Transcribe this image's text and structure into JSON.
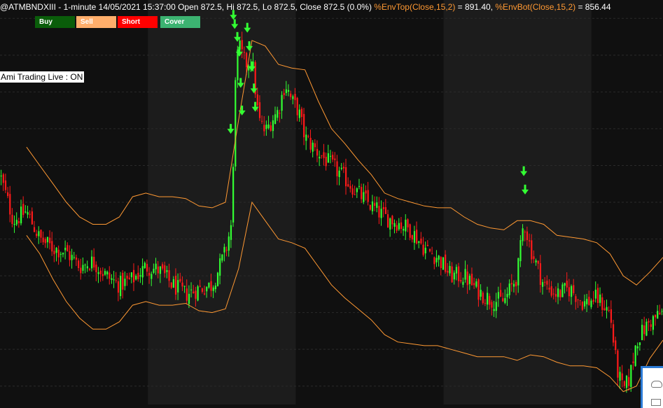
{
  "header": {
    "symbol_info": "@ATMBNDXIII - 1-minute 14/05/2021 15:37:00 Open 872.5, Hi 872.5, Lo 872.5, Close 872.5 (0.0%) ",
    "env_top_label": "%EnvTop(Close,15,2)",
    "env_top_value": " = 891.40, ",
    "env_bot_label": "%EnvBot(Close,15,2)",
    "env_bot_value": " = 856.44"
  },
  "toolbar": {
    "buy_label": "Buy",
    "sell_label": "Sell",
    "short_label": "Short",
    "cover_label": "Cover"
  },
  "status": {
    "text": "Ami Trading Live : ON"
  },
  "colors": {
    "background": "#101010",
    "band_alt": "#1c1c1c",
    "grid": "#2a2a2a",
    "up_candle": "#33ff33",
    "down_candle": "#ff1a1a",
    "envelope": "#ff9933",
    "signal_arrow": "#33ff33"
  },
  "chart_data": {
    "type": "candlestick",
    "interval": "1-minute",
    "date": "14/05/2021",
    "last_bar": {
      "time": "15:37:00",
      "open": 872.5,
      "high": 872.5,
      "low": 872.5,
      "close": 872.5,
      "change_pct": 0.0
    },
    "indicators": [
      {
        "name": "%EnvTop(Close,15,2)",
        "value": 891.4,
        "color": "#ff9933"
      },
      {
        "name": "%EnvBot(Close,15,2)",
        "value": 856.44,
        "color": "#ff9933"
      }
    ],
    "x_range": [
      0,
      100
    ],
    "y_range": [
      780,
      1000
    ],
    "grid": true,
    "legend": "top-left",
    "price_path": [
      [
        0,
        905
      ],
      [
        2,
        880
      ],
      [
        4,
        885
      ],
      [
        6,
        870
      ],
      [
        8,
        865
      ],
      [
        10,
        863
      ],
      [
        12,
        855
      ],
      [
        14,
        858
      ],
      [
        16,
        850
      ],
      [
        18,
        845
      ],
      [
        20,
        848
      ],
      [
        22,
        855
      ],
      [
        24,
        853
      ],
      [
        26,
        845
      ],
      [
        28,
        840
      ],
      [
        30,
        843
      ],
      [
        32,
        845
      ],
      [
        34,
        863
      ],
      [
        35,
        880
      ],
      [
        35.5,
        960
      ],
      [
        36,
        975
      ],
      [
        37,
        965
      ],
      [
        38,
        968
      ],
      [
        39,
        935
      ],
      [
        40,
        928
      ],
      [
        41,
        935
      ],
      [
        42,
        940
      ],
      [
        43,
        955
      ],
      [
        44,
        945
      ],
      [
        45,
        940
      ],
      [
        46,
        925
      ],
      [
        48,
        917
      ],
      [
        50,
        910
      ],
      [
        52,
        903
      ],
      [
        54,
        895
      ],
      [
        56,
        888
      ],
      [
        58,
        882
      ],
      [
        60,
        879
      ],
      [
        62,
        875
      ],
      [
        64,
        865
      ],
      [
        66,
        860
      ],
      [
        68,
        850
      ],
      [
        70,
        850
      ],
      [
        72,
        842
      ],
      [
        74,
        837
      ],
      [
        76,
        836
      ],
      [
        78,
        850
      ],
      [
        79,
        880
      ],
      [
        80,
        865
      ],
      [
        82,
        845
      ],
      [
        84,
        840
      ],
      [
        86,
        843
      ],
      [
        88,
        835
      ],
      [
        90,
        838
      ],
      [
        92,
        830
      ],
      [
        93,
        800
      ],
      [
        94,
        787
      ],
      [
        95,
        795
      ],
      [
        96,
        815
      ],
      [
        98,
        825
      ],
      [
        100,
        830
      ]
    ],
    "env_top": [
      [
        4,
        920
      ],
      [
        6,
        910
      ],
      [
        8,
        900
      ],
      [
        10,
        890
      ],
      [
        12,
        882
      ],
      [
        14,
        878
      ],
      [
        16,
        878
      ],
      [
        18,
        882
      ],
      [
        20,
        893
      ],
      [
        22,
        895
      ],
      [
        24,
        893
      ],
      [
        26,
        893
      ],
      [
        28,
        892
      ],
      [
        30,
        888
      ],
      [
        32,
        887
      ],
      [
        34,
        890
      ],
      [
        36,
        935
      ],
      [
        38,
        978
      ],
      [
        40,
        975
      ],
      [
        42,
        965
      ],
      [
        44,
        963
      ],
      [
        46,
        962
      ],
      [
        48,
        945
      ],
      [
        50,
        930
      ],
      [
        52,
        922
      ],
      [
        54,
        913
      ],
      [
        56,
        905
      ],
      [
        58,
        895
      ],
      [
        60,
        892
      ],
      [
        62,
        890
      ],
      [
        64,
        888
      ],
      [
        66,
        887
      ],
      [
        68,
        887
      ],
      [
        70,
        882
      ],
      [
        72,
        878
      ],
      [
        74,
        876
      ],
      [
        76,
        875
      ],
      [
        78,
        880
      ],
      [
        80,
        880
      ],
      [
        82,
        878
      ],
      [
        84,
        872
      ],
      [
        86,
        871
      ],
      [
        88,
        870
      ],
      [
        90,
        868
      ],
      [
        92,
        862
      ],
      [
        94,
        850
      ],
      [
        96,
        845
      ],
      [
        98,
        852
      ],
      [
        100,
        860
      ]
    ],
    "env_bot": [
      [
        4,
        872
      ],
      [
        6,
        862
      ],
      [
        8,
        848
      ],
      [
        10,
        836
      ],
      [
        12,
        827
      ],
      [
        14,
        821
      ],
      [
        16,
        821
      ],
      [
        18,
        825
      ],
      [
        20,
        834
      ],
      [
        22,
        836
      ],
      [
        24,
        834
      ],
      [
        26,
        834
      ],
      [
        28,
        835
      ],
      [
        30,
        831
      ],
      [
        32,
        830
      ],
      [
        34,
        832
      ],
      [
        36,
        854
      ],
      [
        38,
        890
      ],
      [
        40,
        880
      ],
      [
        42,
        870
      ],
      [
        44,
        868
      ],
      [
        46,
        865
      ],
      [
        48,
        855
      ],
      [
        50,
        845
      ],
      [
        52,
        838
      ],
      [
        54,
        832
      ],
      [
        56,
        826
      ],
      [
        58,
        818
      ],
      [
        60,
        814
      ],
      [
        62,
        813
      ],
      [
        64,
        812
      ],
      [
        66,
        812
      ],
      [
        68,
        810
      ],
      [
        70,
        808
      ],
      [
        72,
        806
      ],
      [
        74,
        806
      ],
      [
        76,
        806
      ],
      [
        78,
        804
      ],
      [
        80,
        807
      ],
      [
        82,
        806
      ],
      [
        84,
        803
      ],
      [
        86,
        801
      ],
      [
        88,
        801
      ],
      [
        90,
        800
      ],
      [
        92,
        795
      ],
      [
        94,
        787
      ],
      [
        96,
        790
      ],
      [
        98,
        805
      ],
      [
        100,
        815
      ]
    ],
    "signals": [
      {
        "x": 35.2,
        "price": 990,
        "type": "arrow-down"
      },
      {
        "x": 35.4,
        "price": 985,
        "type": "arrow-down"
      },
      {
        "x": 35.8,
        "price": 978,
        "type": "arrow-down"
      },
      {
        "x": 36.1,
        "price": 970,
        "type": "arrow-down"
      },
      {
        "x": 36.3,
        "price": 953,
        "type": "arrow-down"
      },
      {
        "x": 36.5,
        "price": 938,
        "type": "arrow-down"
      },
      {
        "x": 34.8,
        "price": 928,
        "type": "arrow-down"
      },
      {
        "x": 37.3,
        "price": 983,
        "type": "arrow-down"
      },
      {
        "x": 37.6,
        "price": 973,
        "type": "arrow-down"
      },
      {
        "x": 38.0,
        "price": 962,
        "type": "arrow-down"
      },
      {
        "x": 38.3,
        "price": 950,
        "type": "arrow-down"
      },
      {
        "x": 38.5,
        "price": 940,
        "type": "arrow-down"
      },
      {
        "x": 79.0,
        "price": 905,
        "type": "arrow-down"
      },
      {
        "x": 79.2,
        "price": 895,
        "type": "arrow-down"
      }
    ]
  }
}
